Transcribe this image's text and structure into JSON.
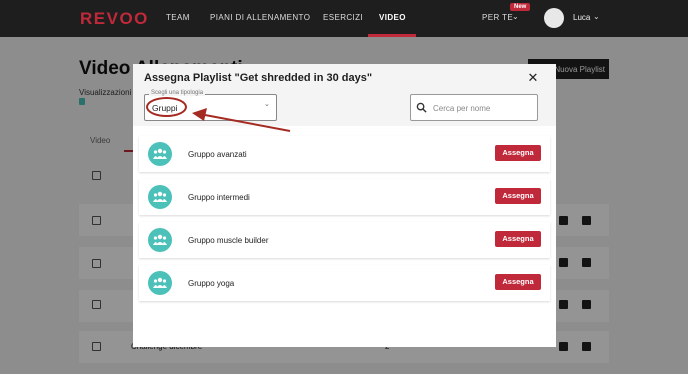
{
  "nav": {
    "logo": "REVOO",
    "items": [
      {
        "label": "TEAM"
      },
      {
        "label": "PIANI DI ALLENAMENTO"
      },
      {
        "label": "ESERCIZI"
      },
      {
        "label": "VIDEO"
      }
    ],
    "for_you": "PER TE",
    "new_badge": "New",
    "user": "Luca"
  },
  "background": {
    "title": "Video Allenamenti",
    "playlist_button": "Nuova Playlist",
    "views_label": "Visualizzazioni",
    "tab": "Video",
    "last_row": "Challenge dicembre",
    "last_row_count": "2"
  },
  "modal": {
    "title": "Assegna Playlist \"Get shredded in 30 days\"",
    "select_label": "Scegli una tipologia",
    "select_value": "Gruppi",
    "search_placeholder": "Cerca per nome",
    "groups": [
      {
        "name": "Gruppo avanzati",
        "button": "Assegna"
      },
      {
        "name": "Gruppo intermedi",
        "button": "Assegna"
      },
      {
        "name": "Gruppo muscle builder",
        "button": "Assegna"
      },
      {
        "name": "Gruppo yoga",
        "button": "Assegna"
      }
    ]
  },
  "colors": {
    "accent": "#c0293a",
    "teal": "#4cc1b9",
    "annotation": "#a52a22"
  }
}
